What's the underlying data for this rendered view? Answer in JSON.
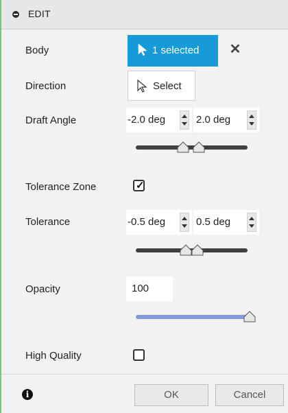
{
  "header": {
    "title": "EDIT"
  },
  "rows": {
    "body": {
      "label": "Body",
      "selected_label": "1 selected",
      "clear_symbol": "✕"
    },
    "direction": {
      "label": "Direction",
      "select_label": "Select"
    },
    "draft_angle": {
      "label": "Draft Angle",
      "min_value": "-2.0 deg",
      "max_value": "2.0 deg"
    },
    "tolerance_zone": {
      "label": "Tolerance Zone",
      "checked": true,
      "check_mark": "✓"
    },
    "tolerance": {
      "label": "Tolerance",
      "min_value": "-0.5 deg",
      "max_value": "0.5 deg"
    },
    "opacity": {
      "label": "Opacity",
      "value": "100",
      "slider_fraction": 1.0
    },
    "high_quality": {
      "label": "High Quality",
      "checked": false
    }
  },
  "footer": {
    "info_symbol": "i",
    "ok_label": "OK",
    "cancel_label": "Cancel"
  },
  "colors": {
    "accent": "#169bd8",
    "slider_dark": "#3f3f3f",
    "slider_blue": "#7f9ad6"
  }
}
